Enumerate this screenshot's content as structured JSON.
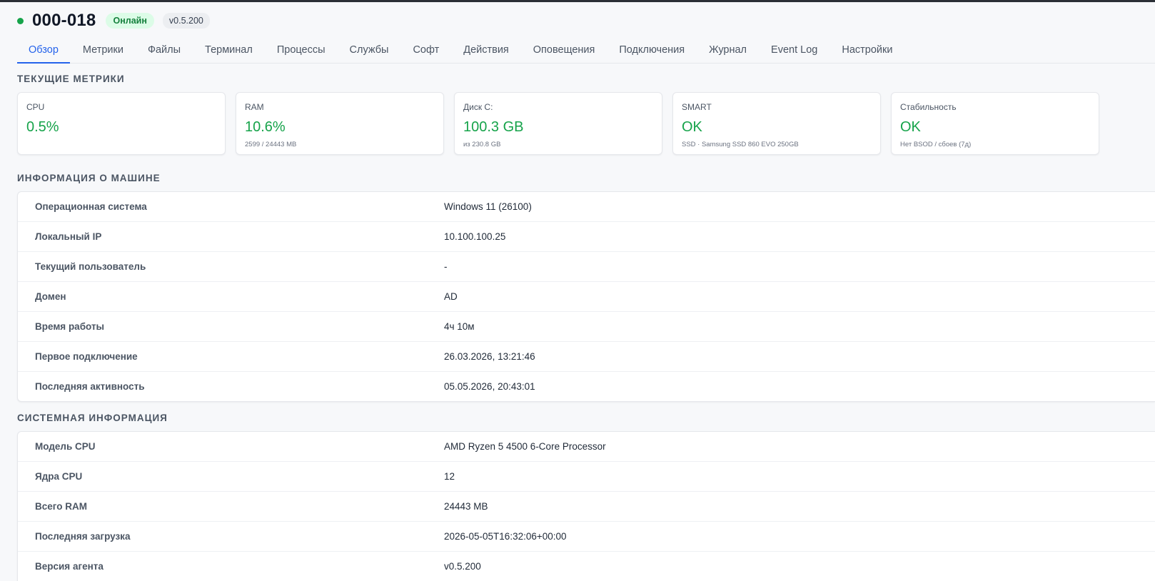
{
  "header": {
    "machine_id": "000-018",
    "status": "Онлайн",
    "version": "v0.5.200"
  },
  "tabs": [
    {
      "label": "Обзор",
      "active": true
    },
    {
      "label": "Метрики"
    },
    {
      "label": "Файлы"
    },
    {
      "label": "Терминал"
    },
    {
      "label": "Процессы"
    },
    {
      "label": "Службы"
    },
    {
      "label": "Софт"
    },
    {
      "label": "Действия"
    },
    {
      "label": "Оповещения"
    },
    {
      "label": "Подключения"
    },
    {
      "label": "Журнал"
    },
    {
      "label": "Event Log"
    },
    {
      "label": "Настройки"
    }
  ],
  "metrics": {
    "title": "ТЕКУЩИЕ МЕТРИКИ",
    "cards": [
      {
        "label": "CPU",
        "value": "0.5%",
        "sub": ""
      },
      {
        "label": "RAM",
        "value": "10.6%",
        "sub": "2599 / 24443 MB"
      },
      {
        "label": "Диск C:",
        "value": "100.3 GB",
        "sub": "из 230.8 GB"
      },
      {
        "label": "SMART",
        "value": "OK",
        "sub": "SSD · Samsung SSD 860 EVO 250GB"
      },
      {
        "label": "Стабильность",
        "value": "OK",
        "sub": "Нет BSOD / сбоев (7д)"
      }
    ]
  },
  "machine_info": {
    "title": "ИНФОРМАЦИЯ О МАШИНЕ",
    "rows": [
      {
        "key": "Операционная система",
        "value": "Windows 11 (26100)"
      },
      {
        "key": "Локальный IP",
        "value": "10.100.100.25"
      },
      {
        "key": "Текущий пользователь",
        "value": "-"
      },
      {
        "key": "Домен",
        "value": "AD"
      },
      {
        "key": "Время работы",
        "value": "4ч 10м"
      },
      {
        "key": "Первое подключение",
        "value": "26.03.2026, 13:21:46"
      },
      {
        "key": "Последняя активность",
        "value": "05.05.2026, 20:43:01"
      }
    ]
  },
  "system_info": {
    "title": "СИСТЕМНАЯ ИНФОРМАЦИЯ",
    "rows": [
      {
        "key": "Модель CPU",
        "value": "AMD Ryzen 5 4500 6-Core Processor"
      },
      {
        "key": "Ядра CPU",
        "value": "12"
      },
      {
        "key": "Всего RAM",
        "value": "24443 MB"
      },
      {
        "key": "Последняя загрузка",
        "value": "2026-05-05T16:32:06+00:00"
      },
      {
        "key": "Версия агента",
        "value": "v0.5.200"
      }
    ]
  },
  "colors": {
    "accent": "#2563eb",
    "online": "#16a34a",
    "online_bg": "#dcfce7"
  }
}
